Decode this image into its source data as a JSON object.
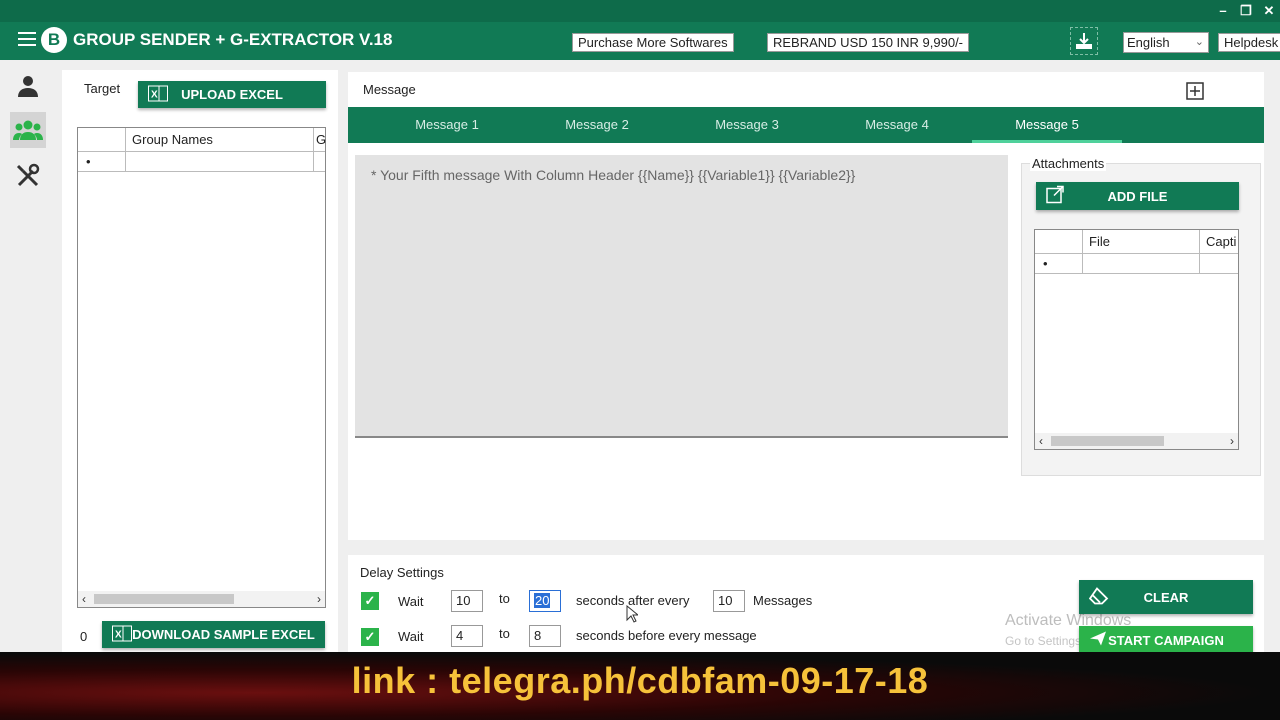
{
  "app": {
    "logo_letter": "B",
    "title": "GROUP SENDER + G-EXTRACTOR V.18",
    "purchase_label": "Purchase More Softwares",
    "rebrand_label": "REBRAND USD 150 INR 9,990/-",
    "language": "English",
    "helpdesk_label": "Helpdesk",
    "accent_color": "#117a55"
  },
  "window_controls": {
    "minimize": "–",
    "restore": "❐",
    "close": "✕"
  },
  "sidebar": {
    "items": [
      {
        "icon": "user-icon"
      },
      {
        "icon": "group-icon",
        "active": true
      },
      {
        "icon": "tools-icon"
      }
    ]
  },
  "target": {
    "label": "Target",
    "upload_label": "UPLOAD EXCEL",
    "columns": [
      "Group Names",
      "G"
    ],
    "new_row_marker": "•",
    "count": "0",
    "download_label": "DOWNLOAD SAMPLE EXCEL"
  },
  "message": {
    "label": "Message",
    "tabs": [
      "Message 1",
      "Message 2",
      "Message 3",
      "Message 4",
      "Message 5"
    ],
    "active_tab": "Message 5",
    "placeholder": "* Your Fifth message With Column Header {{Name}} {{Variable1}} {{Variable2}}"
  },
  "attachments": {
    "label": "Attachments",
    "add_file_label": "ADD FILE",
    "columns": [
      "File",
      "Capti"
    ],
    "new_row_marker": "•"
  },
  "delay": {
    "label": "Delay Settings",
    "row1": {
      "checked": true,
      "wait": "Wait",
      "from": "10",
      "to_label": "to",
      "to": "20",
      "after": "seconds after every",
      "count": "10",
      "unit": "Messages"
    },
    "row2": {
      "checked": true,
      "wait": "Wait",
      "from": "4",
      "to_label": "to",
      "to": "8",
      "after": "seconds before every message"
    }
  },
  "actions": {
    "clear_label": "CLEAR",
    "start_label": "START CAMPAIGN"
  },
  "watermark": {
    "line1": "Activate Windows",
    "line2": "Go to Settings"
  },
  "banner": {
    "text": "link : telegra.ph/cdbfam-09-17-18",
    "text_color": "#f6c23a"
  }
}
